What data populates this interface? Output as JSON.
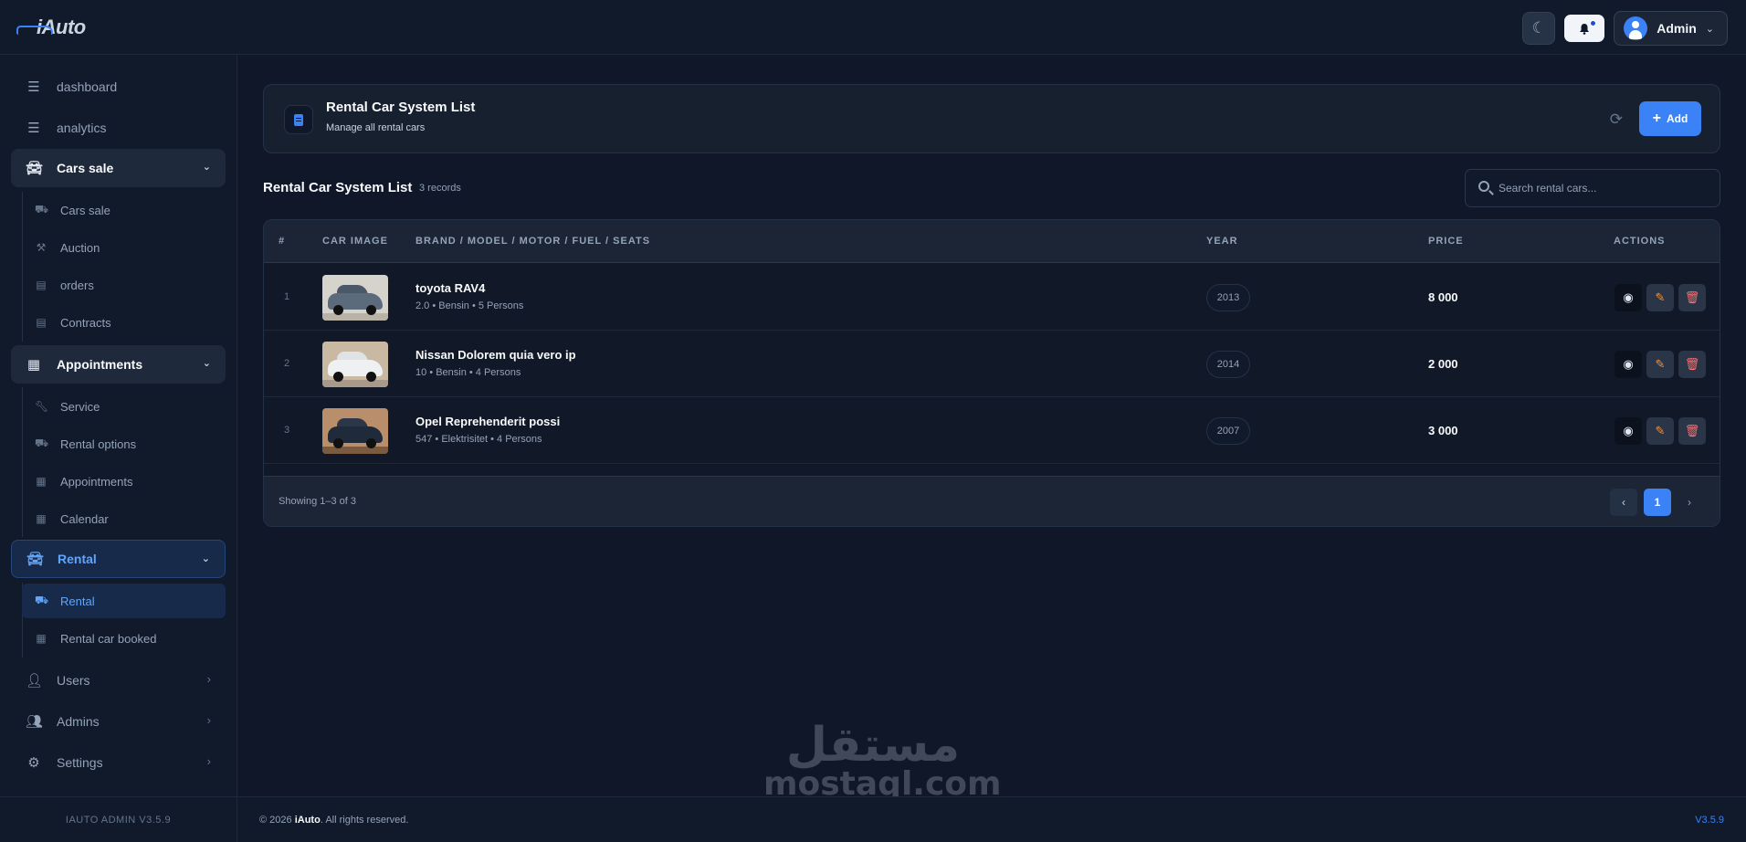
{
  "brand": {
    "logo_text": "iAuto"
  },
  "topbar": {
    "user_name": "Admin"
  },
  "sidebar": {
    "items": [
      {
        "label": "dashboard",
        "icon": "chart-icon"
      },
      {
        "label": "analytics",
        "icon": "chart-icon"
      }
    ],
    "groups": {
      "cars_sale": {
        "label": "Cars sale",
        "items": [
          "Cars sale",
          "Auction",
          "orders",
          "Contracts"
        ]
      },
      "appointments": {
        "label": "Appointments",
        "items": [
          "Service",
          "Rental options",
          "Appointments",
          "Calendar"
        ]
      },
      "rental": {
        "label": "Rental",
        "items": [
          "Rental",
          "Rental car booked"
        ]
      }
    },
    "bottom_items": [
      "Users",
      "Admins",
      "Settings"
    ],
    "version_text": "IAUTO ADMIN V3.5.9"
  },
  "page_header": {
    "title": "Rental Car System List",
    "subtitle": "Manage all rental cars",
    "add_label": "Add"
  },
  "list": {
    "title": "Rental Car System List",
    "count": "3 records",
    "search_placeholder": "Search rental cars..."
  },
  "table": {
    "columns": [
      "#",
      "CAR IMAGE",
      "BRAND / MODEL / MOTOR / FUEL / SEATS",
      "YEAR",
      "PRICE",
      "ACTIONS"
    ],
    "rows": [
      {
        "num": "1",
        "name": "toyota RAV4",
        "meta": "2.0 • Bensin • 5 Persons",
        "year": "2013",
        "price": "8 000",
        "car_color": "#5b6b7c"
      },
      {
        "num": "2",
        "name": "Nissan Dolorem quia vero ip",
        "meta": "10 • Bensin • 4 Persons",
        "year": "2014",
        "price": "2 000",
        "car_color": "#eef0f2"
      },
      {
        "num": "3",
        "name": "Opel Reprehenderit possi",
        "meta": "547 • Elektrisitet • 4 Persons",
        "year": "2007",
        "price": "3 000",
        "car_color": "#1f2a3a"
      }
    ],
    "showing": "Showing 1–3 of 3",
    "current_page": "1"
  },
  "footer": {
    "copy_prefix": "© 2026",
    "copy_brand": "iAuto",
    "copy_suffix": ". All rights reserved.",
    "version": "V3.5.9"
  },
  "watermark": {
    "arabic": "مستقل",
    "latin": "mostaql.com"
  },
  "colors": {
    "accent": "#3b82f6",
    "background": "#0f1729",
    "card": "#17202f"
  }
}
